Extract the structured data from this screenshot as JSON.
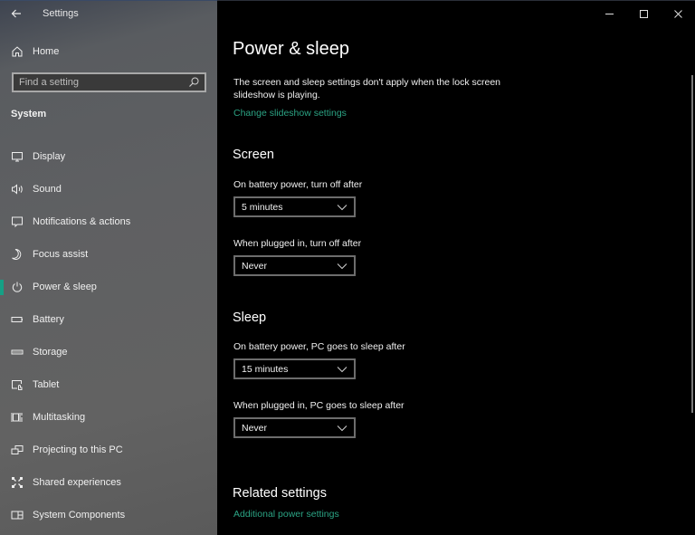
{
  "window": {
    "title": "Settings",
    "controls": {
      "minimize": "minimize",
      "maximize": "maximize",
      "close": "close"
    }
  },
  "sidebar": {
    "back_icon": "back-arrow-icon",
    "home": {
      "label": "Home",
      "icon": "home-icon"
    },
    "search": {
      "placeholder": "Find a setting",
      "value": "",
      "icon": "search-icon"
    },
    "section": "System",
    "items": [
      {
        "label": "Display",
        "icon": "display-icon",
        "active": false
      },
      {
        "label": "Sound",
        "icon": "sound-icon",
        "active": false
      },
      {
        "label": "Notifications & actions",
        "icon": "notifications-icon",
        "active": false
      },
      {
        "label": "Focus assist",
        "icon": "moon-icon",
        "active": false
      },
      {
        "label": "Power & sleep",
        "icon": "power-icon",
        "active": true
      },
      {
        "label": "Battery",
        "icon": "battery-icon",
        "active": false
      },
      {
        "label": "Storage",
        "icon": "storage-icon",
        "active": false
      },
      {
        "label": "Tablet",
        "icon": "tablet-icon",
        "active": false
      },
      {
        "label": "Multitasking",
        "icon": "multitasking-icon",
        "active": false
      },
      {
        "label": "Projecting to this PC",
        "icon": "projecting-icon",
        "active": false
      },
      {
        "label": "Shared experiences",
        "icon": "shared-experiences-icon",
        "active": false
      },
      {
        "label": "System Components",
        "icon": "system-components-icon",
        "active": false
      }
    ]
  },
  "main": {
    "title": "Power & sleep",
    "description": "The screen and sleep settings don't apply when the lock screen slideshow is playing.",
    "slideshow_link": "Change slideshow settings",
    "screen": {
      "heading": "Screen",
      "battery_label": "On battery power, turn off after",
      "battery_value": "5 minutes",
      "plugged_label": "When plugged in, turn off after",
      "plugged_value": "Never"
    },
    "sleep": {
      "heading": "Sleep",
      "battery_label": "On battery power, PC goes to sleep after",
      "battery_value": "15 minutes",
      "plugged_label": "When plugged in, PC goes to sleep after",
      "plugged_value": "Never"
    },
    "related": {
      "heading": "Related settings",
      "link": "Additional power settings"
    }
  },
  "colors": {
    "accent": "#16a085",
    "link": "#2ba484",
    "content_bg": "#000000",
    "sidebar_bg": "#606060"
  }
}
